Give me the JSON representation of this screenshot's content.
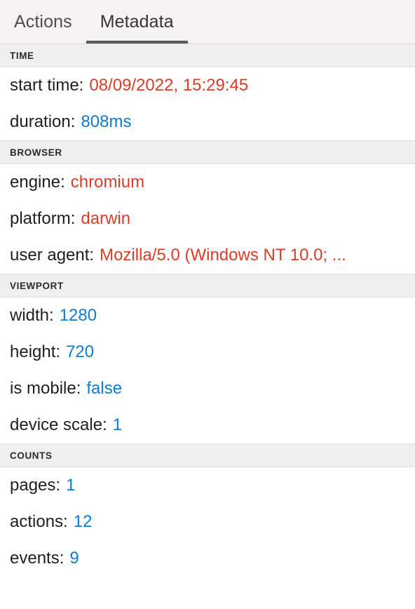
{
  "tabs": [
    {
      "label": "Actions",
      "selected": false
    },
    {
      "label": "Metadata",
      "selected": true
    }
  ],
  "colors": {
    "string_value": "#df3b24",
    "number_value": "#0c7cd5",
    "tab_underline": "#5a5a5a",
    "section_header_bg": "#efefee"
  },
  "sections": [
    {
      "title": "TIME",
      "rows": [
        {
          "key": "start time:",
          "value": "08/09/2022, 15:29:45",
          "type": "str"
        },
        {
          "key": "duration:",
          "value": "808ms",
          "type": "num"
        }
      ]
    },
    {
      "title": "BROWSER",
      "rows": [
        {
          "key": "engine:",
          "value": "chromium",
          "type": "str"
        },
        {
          "key": "platform:",
          "value": "darwin",
          "type": "str"
        },
        {
          "key": "user agent:",
          "value": "Mozilla/5.0 (Windows NT 10.0; ...",
          "type": "str"
        }
      ]
    },
    {
      "title": "VIEWPORT",
      "rows": [
        {
          "key": "width:",
          "value": "1280",
          "type": "num"
        },
        {
          "key": "height:",
          "value": "720",
          "type": "num"
        },
        {
          "key": "is mobile:",
          "value": "false",
          "type": "bool"
        },
        {
          "key": "device scale:",
          "value": "1",
          "type": "num"
        }
      ]
    },
    {
      "title": "COUNTS",
      "rows": [
        {
          "key": "pages:",
          "value": "1",
          "type": "num"
        },
        {
          "key": "actions:",
          "value": "12",
          "type": "num"
        },
        {
          "key": "events:",
          "value": "9",
          "type": "num"
        }
      ]
    }
  ]
}
